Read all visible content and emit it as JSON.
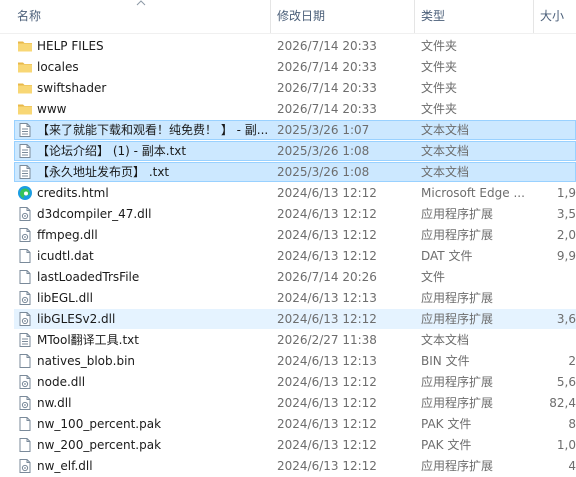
{
  "columns": {
    "name": "名称",
    "date": "修改日期",
    "type": "类型",
    "size": "大小"
  },
  "files": [
    {
      "name": "HELP FILES",
      "date": "2026/7/14 20:33",
      "type": "文件夹",
      "size": "",
      "icon": "folder-icon"
    },
    {
      "name": "locales",
      "date": "2026/7/14 20:33",
      "type": "文件夹",
      "size": "",
      "icon": "folder-icon"
    },
    {
      "name": "swiftshader",
      "date": "2026/7/14 20:33",
      "type": "文件夹",
      "size": "",
      "icon": "folder-icon"
    },
    {
      "name": "www",
      "date": "2026/7/14 20:33",
      "type": "文件夹",
      "size": "",
      "icon": "folder-icon"
    },
    {
      "name": "【来了就能下载和观看！纯免费！ 】 - 副...",
      "date": "2025/3/26 1:07",
      "type": "文本文档",
      "size": "",
      "icon": "text-file-icon",
      "selected": true
    },
    {
      "name": "【论坛介绍】 (1) - 副本.txt",
      "date": "2025/3/26 1:08",
      "type": "文本文档",
      "size": "",
      "icon": "text-file-icon",
      "selected": true
    },
    {
      "name": "【永久地址发布页】 .txt",
      "date": "2025/3/26 1:08",
      "type": "文本文档",
      "size": "",
      "icon": "text-file-icon",
      "selected": true
    },
    {
      "name": "credits.html",
      "date": "2024/6/13 12:12",
      "type": "Microsoft Edge ...",
      "size": "1,9",
      "icon": "edge-icon"
    },
    {
      "name": "d3dcompiler_47.dll",
      "date": "2024/6/13 12:12",
      "type": "应用程序扩展",
      "size": "3,5",
      "icon": "dll-file-icon"
    },
    {
      "name": "ffmpeg.dll",
      "date": "2024/6/13 12:12",
      "type": "应用程序扩展",
      "size": "2,0",
      "icon": "dll-file-icon"
    },
    {
      "name": "icudtl.dat",
      "date": "2024/6/13 12:12",
      "type": "DAT 文件",
      "size": "9,9",
      "icon": "file-icon"
    },
    {
      "name": "lastLoadedTrsFile",
      "date": "2026/7/14 20:26",
      "type": "文件",
      "size": "",
      "icon": "file-icon"
    },
    {
      "name": "libEGL.dll",
      "date": "2024/6/13 12:13",
      "type": "应用程序扩展",
      "size": "",
      "icon": "dll-file-icon"
    },
    {
      "name": "libGLESv2.dll",
      "date": "2024/6/13 12:12",
      "type": "应用程序扩展",
      "size": "3,6",
      "icon": "dll-file-icon",
      "hover": true
    },
    {
      "name": "MTool翻译工具.txt",
      "date": "2026/2/27 11:38",
      "type": "文本文档",
      "size": "",
      "icon": "text-file-icon"
    },
    {
      "name": "natives_blob.bin",
      "date": "2024/6/13 12:13",
      "type": "BIN 文件",
      "size": "2",
      "icon": "file-icon"
    },
    {
      "name": "node.dll",
      "date": "2024/6/13 12:12",
      "type": "应用程序扩展",
      "size": "5,6",
      "icon": "dll-file-icon"
    },
    {
      "name": "nw.dll",
      "date": "2024/6/13 12:12",
      "type": "应用程序扩展",
      "size": "82,4",
      "icon": "dll-file-icon"
    },
    {
      "name": "nw_100_percent.pak",
      "date": "2024/6/13 12:12",
      "type": "PAK 文件",
      "size": "8",
      "icon": "file-icon"
    },
    {
      "name": "nw_200_percent.pak",
      "date": "2024/6/13 12:12",
      "type": "PAK 文件",
      "size": "1,0",
      "icon": "file-icon"
    },
    {
      "name": "nw_elf.dll",
      "date": "2024/6/13 12:12",
      "type": "应用程序扩展",
      "size": "4",
      "icon": "dll-file-icon"
    }
  ],
  "colors": {
    "folder": "#f8d775",
    "selection": "#cce8ff",
    "selection_border": "#99d1ff",
    "header_text": "#4c607a",
    "secondary_text": "#6d6d6d"
  }
}
